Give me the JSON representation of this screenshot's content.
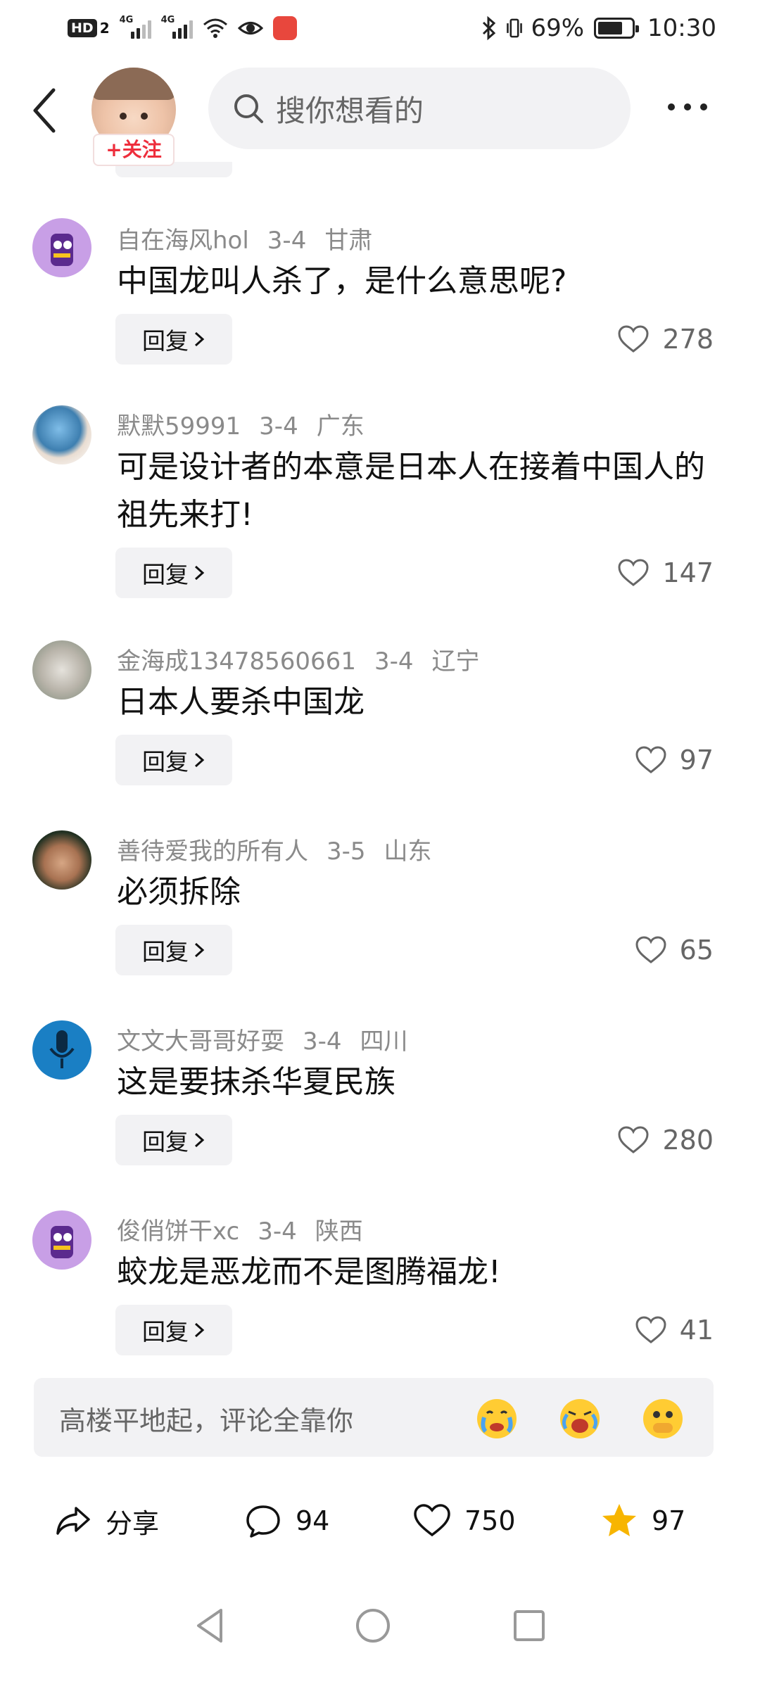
{
  "status_bar": {
    "hd": "HD",
    "sim": "2",
    "net1": "4G",
    "net2": "4G",
    "battery_pct": "69%",
    "battery_level": 0.69,
    "time": "10:30"
  },
  "header": {
    "follow_label": "+关注",
    "search_placeholder": "搜你想看的"
  },
  "comments": [
    {
      "user": "自在海风hol",
      "date": "3-4",
      "region": "甘肃",
      "text": "中国龙叫人杀了，是什么意思呢?",
      "reply": "回复",
      "likes": "278",
      "avatar": "purple-cartoon"
    },
    {
      "user": "默默59991",
      "date": "3-4",
      "region": "广东",
      "text": "可是设计者的本意是日本人在接着中国人的祖先来打!",
      "reply": "回复",
      "likes": "147",
      "avatar": "earth-in-hands"
    },
    {
      "user": "金海成13478560661",
      "date": "3-4",
      "region": "辽宁",
      "text": "日本人要杀中国龙",
      "reply": "回复",
      "likes": "97",
      "avatar": "dog-photo"
    },
    {
      "user": "善待爱我的所有人",
      "date": "3-5",
      "region": "山东",
      "text": "必须拆除",
      "reply": "回复",
      "likes": "65",
      "avatar": "man-portrait"
    },
    {
      "user": "文文大哥哥好耍",
      "date": "3-4",
      "region": "四川",
      "text": "这是要抹杀华夏民族",
      "reply": "回复",
      "likes": "280",
      "avatar": "microphone"
    },
    {
      "user": "俊俏饼干xc",
      "date": "3-4",
      "region": "陕西",
      "text": "蛟龙是恶龙而不是图腾福龙!",
      "reply": "回复",
      "likes": "41",
      "avatar": "purple-cartoon"
    }
  ],
  "comment_input": {
    "placeholder": "高楼平地起，评论全靠你",
    "emojis": [
      "crying-emoji",
      "wailing-emoji",
      "covering-mouth-emoji"
    ]
  },
  "actions": {
    "share": "分享",
    "comments": "94",
    "likes": "750",
    "favorites": "97"
  },
  "colors": {
    "accent_red": "#ee2e3c",
    "star_gold": "#f7b500",
    "chip_bg": "#f2f2f4",
    "meta_gray": "#8a8a8a"
  }
}
